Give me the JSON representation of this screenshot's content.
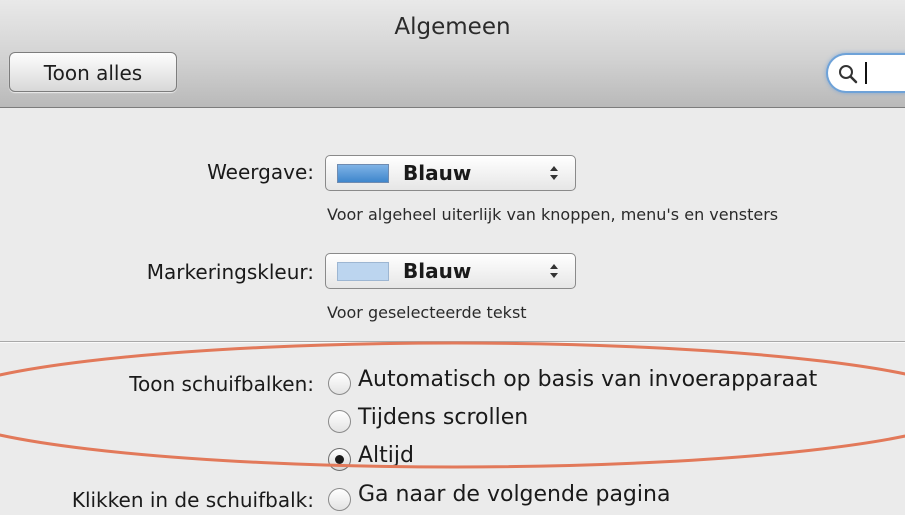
{
  "window": {
    "title": "Algemeen"
  },
  "toolbar": {
    "show_all_label": "Toon alles"
  },
  "search": {
    "value": ""
  },
  "appearance": {
    "label": "Weergave:",
    "selected": "Blauw",
    "swatch_color": "#5b9bd5",
    "hint": "Voor algeheel uiterlijk van knoppen, menu's en vensters"
  },
  "highlight": {
    "label": "Markeringskleur:",
    "selected": "Blauw",
    "swatch_color": "#b9d4f0",
    "hint": "Voor geselecteerde tekst"
  },
  "scrollbars": {
    "label": "Toon schuifbalken:",
    "options": [
      {
        "label": "Automatisch op basis van invoerapparaat",
        "checked": false
      },
      {
        "label": "Tijdens scrollen",
        "checked": false
      },
      {
        "label": "Altijd",
        "checked": true
      }
    ]
  },
  "scrollbar_click": {
    "label": "Klikken in de schuifbalk:",
    "options": [
      {
        "label": "Ga naar de volgende pagina",
        "checked": false
      }
    ]
  },
  "annotation": {
    "ellipse_color": "#e2795a"
  }
}
